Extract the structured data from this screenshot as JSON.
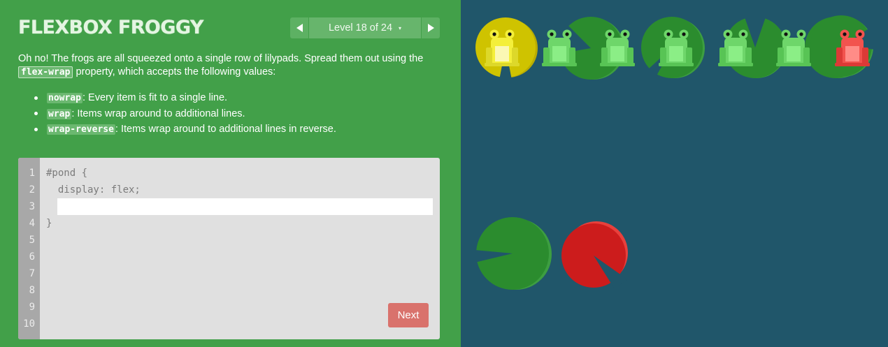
{
  "app": {
    "title": "FLEXBOX FROGGY"
  },
  "level_nav": {
    "label": "Level 18 of 24",
    "caret": "▾",
    "prev_icon": "left-arrow-icon",
    "next_icon": "right-arrow-icon"
  },
  "instructions": {
    "intro_before": "Oh no! The frogs are all squeezed onto a single row of lilypads. Spread them out using the",
    "property": "flex-wrap",
    "intro_after": " property, which accepts the following values:",
    "values": [
      {
        "code": "nowrap",
        "text": ": Every item is fit to a single line."
      },
      {
        "code": "wrap",
        "text": ": Items wrap around to additional lines."
      },
      {
        "code": "wrap-reverse",
        "text": ": Items wrap around to additional lines in reverse."
      }
    ]
  },
  "editor": {
    "line_numbers": [
      "1",
      "2",
      "3",
      "4",
      "5",
      "6",
      "7",
      "8",
      "9",
      "10"
    ],
    "lines": {
      "l1": "#pond {",
      "l2": "  display: flex;",
      "l4": "}"
    },
    "input_value": "",
    "next_label": "Next"
  },
  "pond": {
    "frogs": [
      "yellow",
      "green",
      "green",
      "green",
      "green",
      "green",
      "red"
    ],
    "lilypads": [
      "yellow",
      "green",
      "green",
      "green",
      "green",
      "green",
      "green",
      "red"
    ]
  },
  "colors": {
    "sidebar_bg": "#42a049",
    "pond_bg": "#20566a",
    "yellow_pad": "#cfc300",
    "green_pad": "#2b8c2e",
    "red_pad": "#cc1c1c",
    "next_button": "#d9726c"
  }
}
